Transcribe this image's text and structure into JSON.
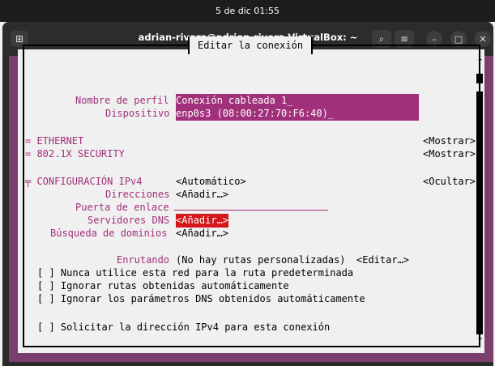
{
  "system": {
    "clock": "5 de dic  01:55"
  },
  "window": {
    "title": "adrian-rivera@adrian-rivera-VirtualBox: ~"
  },
  "dialog": {
    "title": "Editar la conexión",
    "profile_name_label": "Nombre de perfil",
    "profile_name_value": "Conexión cableada 1_",
    "device_label": "Dispositivo",
    "device_value": "enp0s3 (08:00:27:70:F6:40)_",
    "ethernet_section": "= ETHERNET",
    "ethernet_toggle": "<Mostrar>",
    "security_section": "= 802.1X SECURITY",
    "security_toggle": "<Mostrar>",
    "ipv4_section": "╤ CONFIGURACIÓN IPv4",
    "ipv4_mode": "<Automático>",
    "ipv4_toggle": "<Ocultar>",
    "addresses_label": "Direcciones",
    "addresses_button": "<Añadir…>",
    "gateway_label": "Puerta de enlace",
    "dns_label": "Servidores DNS",
    "dns_button": "<Añadir…>",
    "search_domains_label": "Búsqueda de dominios",
    "search_domains_button": "<Añadir…>",
    "routing_label": "Enrutando",
    "routing_value": "(No hay rutas personalizadas)",
    "routing_edit": "<Editar…>",
    "check_never_default": "[ ] Nunca utilice esta red para la ruta predeterminada",
    "check_ignore_routes": "[ ] Ignorar rutas obtenidas automáticamente",
    "check_ignore_dns": "[ ] Ignorar los parámetros DNS obtenidos automáticamente",
    "check_require_ipv4": "[ ] Solicitar la dirección IPv4 para esta conexión"
  },
  "scrollbar": {
    "up": "↑",
    "down": "↓"
  },
  "icons": {
    "newtab": "⊞",
    "search": "⌕",
    "menu": "≡",
    "minimize": "–",
    "maximize": "□",
    "close": "✕"
  },
  "colors": {
    "terminal_bg": "#7a3f6c",
    "label": "#a1307a",
    "highlight": "#d3171b",
    "dialog_bg": "#f0f0f0"
  }
}
